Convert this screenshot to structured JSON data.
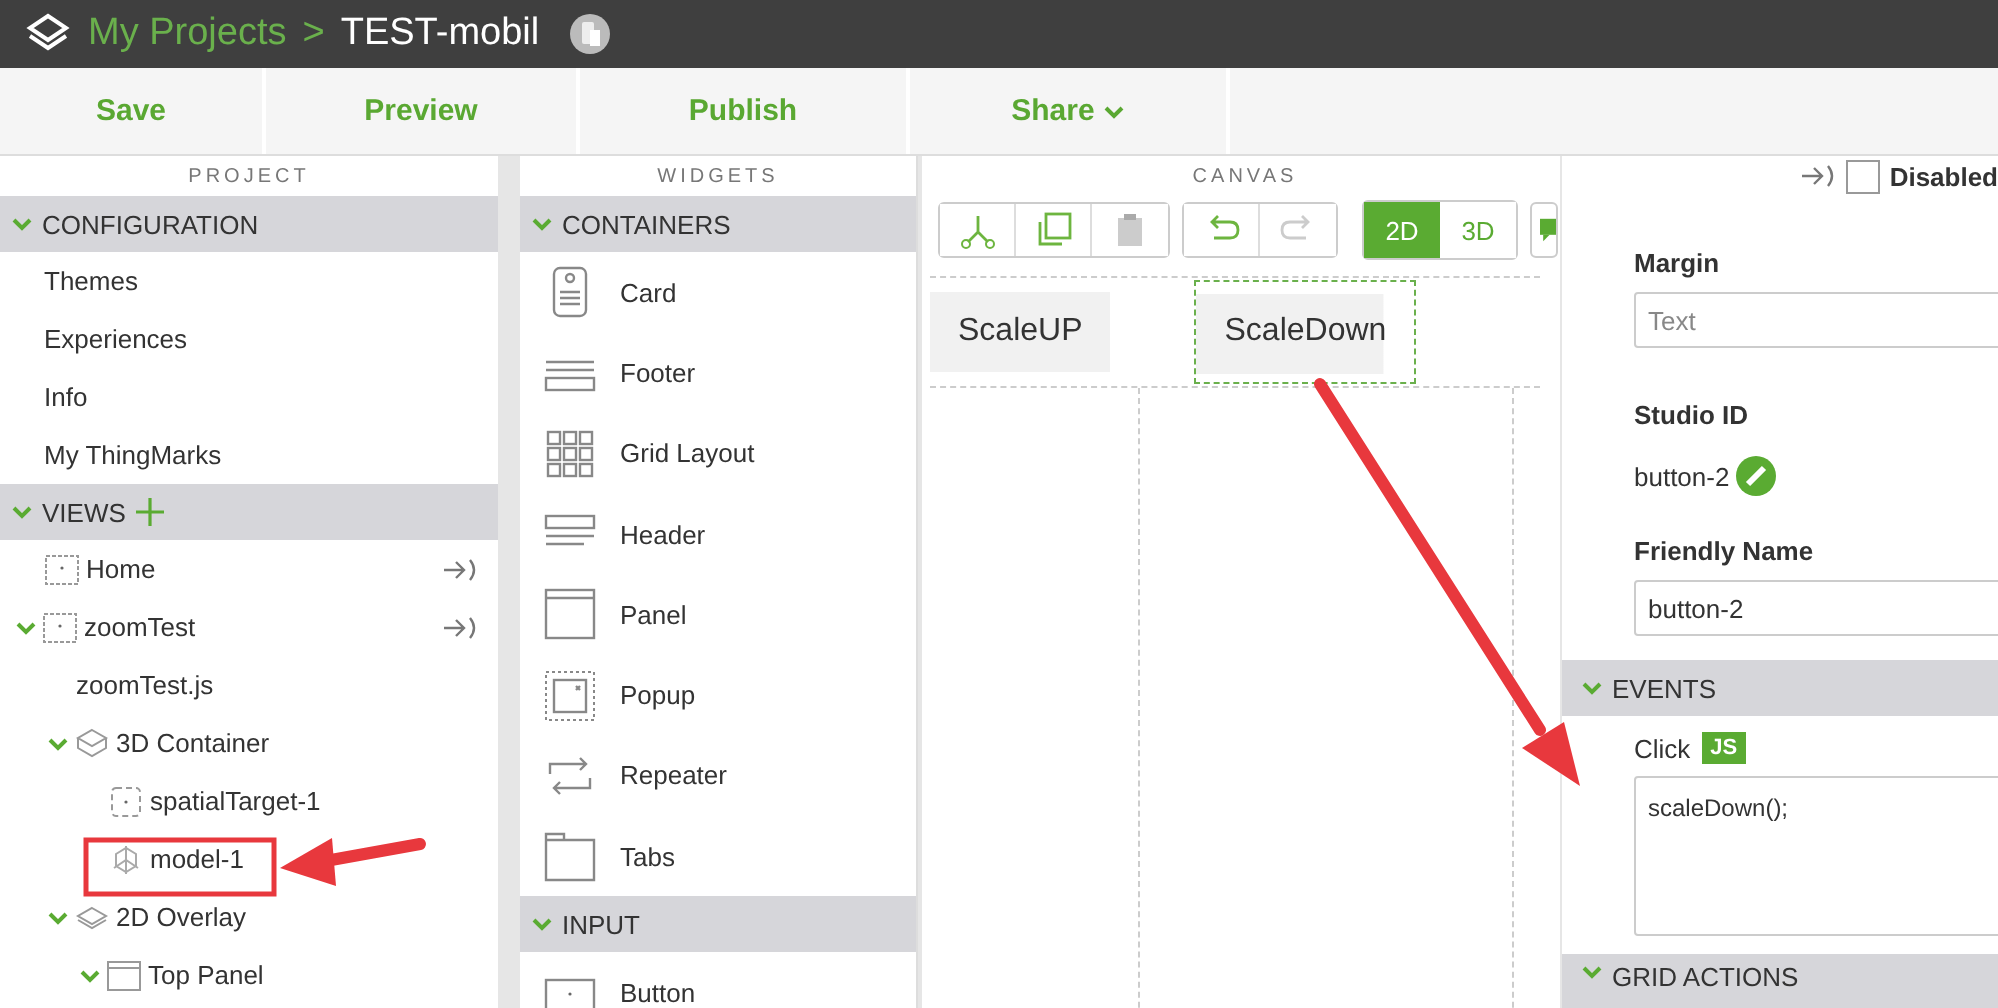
{
  "header": {
    "breadcrumb_root": "My Projects",
    "separator": ">",
    "project": "TEST-mobil"
  },
  "toolbar": [
    {
      "label": "Save",
      "kind": "plain"
    },
    {
      "label": "Preview",
      "kind": "plain"
    },
    {
      "label": "Publish",
      "kind": "plain"
    },
    {
      "label": "Share",
      "kind": "menu"
    }
  ],
  "project": {
    "title": "PROJECT",
    "sections": [
      {
        "title": "CONFIGURATION",
        "expanded": true,
        "addable": false,
        "items": [
          {
            "label": "Themes",
            "kind": "text"
          },
          {
            "label": "Experiences",
            "kind": "text"
          },
          {
            "label": "Info",
            "kind": "text"
          },
          {
            "label": "My ThingMarks",
            "kind": "text"
          }
        ]
      },
      {
        "title": "VIEWS",
        "expanded": true,
        "addable": true,
        "items": [
          {
            "label": "Home",
            "kind": "view"
          },
          {
            "label": "zoomTest",
            "kind": "view",
            "expanded": true,
            "children": [
              {
                "label": "zoomTest.js",
                "kind": "text"
              },
              {
                "label": "3D Container",
                "kind": "container3d",
                "expanded": true,
                "children": [
                  {
                    "label": "spatialTarget-1",
                    "kind": "target"
                  },
                  {
                    "label": "model-1",
                    "kind": "model"
                  }
                ]
              },
              {
                "label": "2D Overlay",
                "kind": "overlay2d",
                "expanded": true,
                "children": [
                  {
                    "label": "Top Panel",
                    "kind": "panel",
                    "expanded": true
                  }
                ]
              }
            ]
          }
        ]
      }
    ]
  },
  "widgets": {
    "title": "WIDGETS",
    "sections": [
      {
        "title": "CONTAINERS",
        "expanded": true,
        "items": [
          {
            "label": "Card",
            "kind": "card"
          },
          {
            "label": "Footer",
            "kind": "footer"
          },
          {
            "label": "Grid Layout",
            "kind": "grid"
          },
          {
            "label": "Header",
            "kind": "header"
          },
          {
            "label": "Panel",
            "kind": "panel"
          },
          {
            "label": "Popup",
            "kind": "popup"
          },
          {
            "label": "Repeater",
            "kind": "repeater"
          },
          {
            "label": "Tabs",
            "kind": "tabs"
          }
        ]
      },
      {
        "title": "INPUT",
        "expanded": true,
        "items": [
          {
            "label": "Button",
            "kind": "button"
          }
        ]
      }
    ]
  },
  "canvas": {
    "title": "CANVAS",
    "tools": [
      {
        "kind": "cut",
        "disabled": false
      },
      {
        "kind": "copy",
        "disabled": false
      },
      {
        "kind": "paste",
        "disabled": true
      },
      {
        "kind": "undo",
        "disabled": false
      },
      {
        "kind": "redo",
        "disabled": true
      }
    ],
    "modes": [
      {
        "label": "2D",
        "selected": true
      },
      {
        "label": "3D",
        "selected": false
      }
    ],
    "buttons": [
      {
        "label": "ScaleUP",
        "selected": false
      },
      {
        "label": "ScaleDown",
        "selected": true
      }
    ]
  },
  "properties": {
    "disabled": {
      "label": "Disabled",
      "checked": false
    },
    "margin": {
      "label": "Margin",
      "placeholder": "Text"
    },
    "studio_id": {
      "label": "Studio ID",
      "value": "button-2"
    },
    "friendly_name": {
      "label": "Friendly Name",
      "value": "button-2"
    },
    "events": {
      "title": "EVENTS",
      "expanded": true,
      "event": "Click",
      "badge": "JS",
      "code": "scaleDown();"
    },
    "next_section": {
      "title": "GRID ACTIONS",
      "expanded": true
    }
  }
}
